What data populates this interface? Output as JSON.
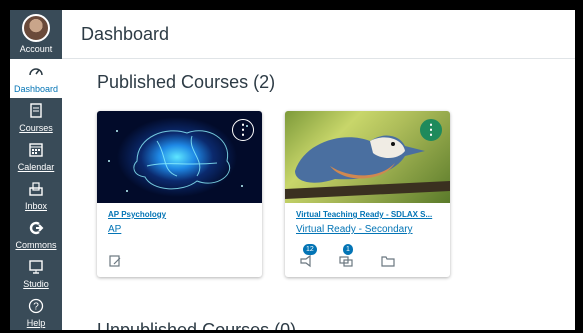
{
  "sidebar": {
    "account_label": "Account",
    "items": [
      {
        "label": "Dashboard",
        "icon": "dashboard-icon"
      },
      {
        "label": "Courses",
        "icon": "courses-icon"
      },
      {
        "label": "Calendar",
        "icon": "calendar-icon"
      },
      {
        "label": "Inbox",
        "icon": "inbox-icon"
      },
      {
        "label": "Commons",
        "icon": "commons-icon"
      },
      {
        "label": "Studio",
        "icon": "studio-icon"
      },
      {
        "label": "Help",
        "icon": "help-icon"
      }
    ]
  },
  "header": {
    "title": "Dashboard"
  },
  "published": {
    "title": "Published Courses (2)"
  },
  "unpublished": {
    "title": "Unpublished Courses (0)"
  },
  "cards": [
    {
      "title": "AP Psychology",
      "subtitle": "AP",
      "color": "#ffffff"
    },
    {
      "title": "Virtual Teaching Ready - SDLAX S...",
      "subtitle": "Virtual Ready - Secondary",
      "color": "#1e8a5c",
      "badges": {
        "announcements": "12",
        "discussions": "1"
      }
    }
  ],
  "colors": {
    "sidebar": "#394b58",
    "link": "#0374b5"
  }
}
